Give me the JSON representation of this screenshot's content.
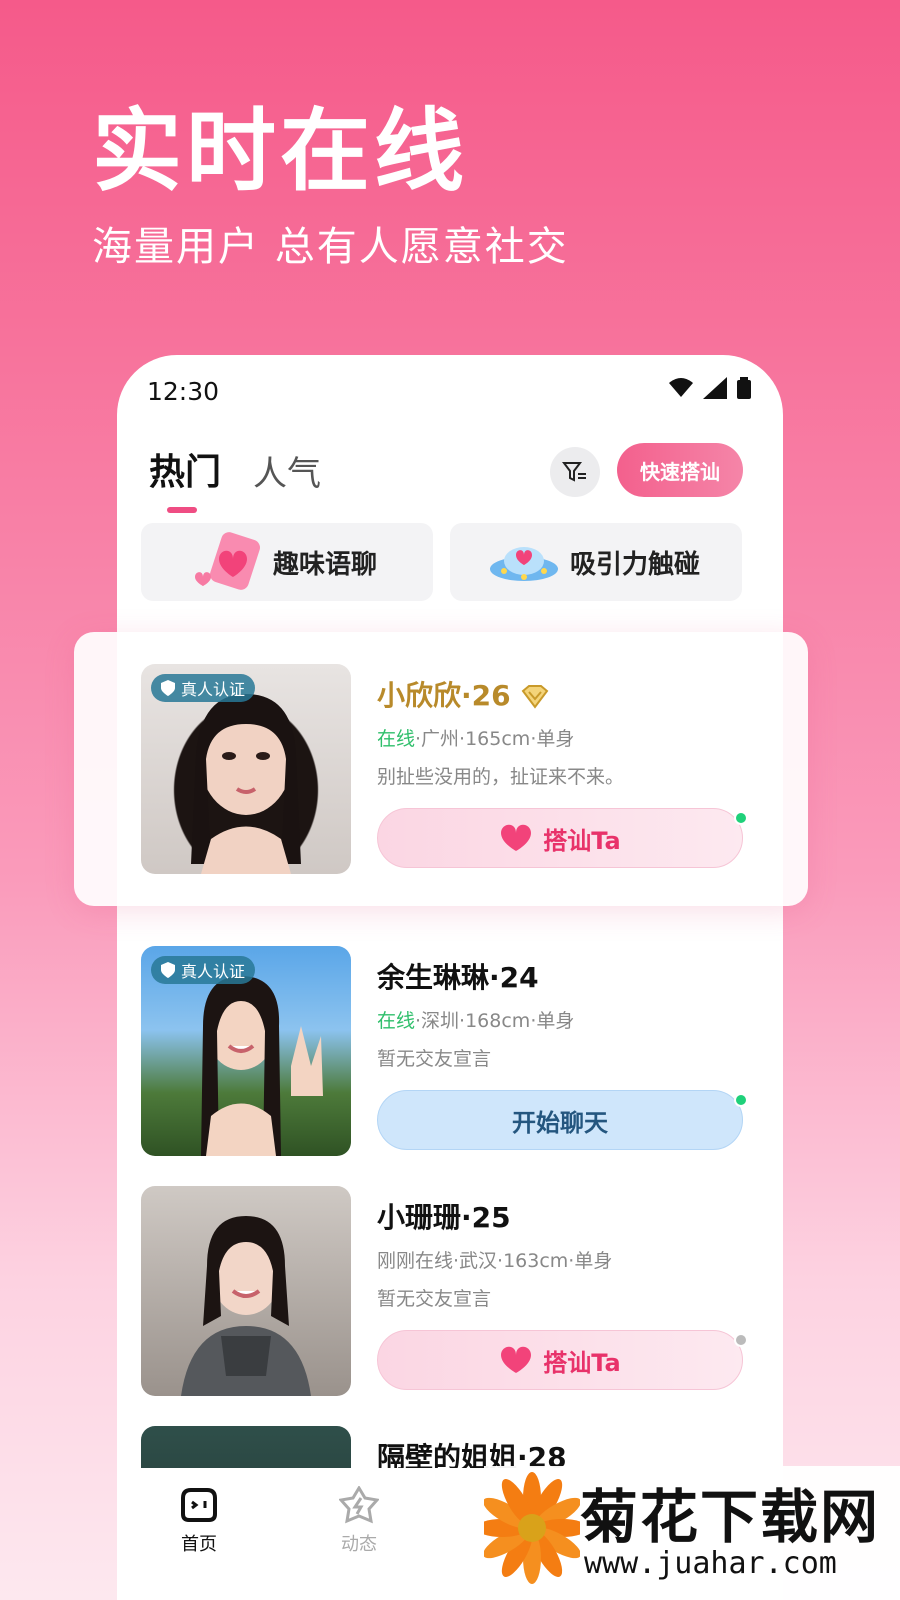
{
  "hero": {
    "title": "实时在线",
    "subtitle": "海量用户 总有人愿意社交"
  },
  "status_bar": {
    "time": "12:30"
  },
  "tabs": [
    {
      "label": "热门",
      "active": true
    },
    {
      "label": "人气",
      "active": false
    }
  ],
  "quick_button": "快速搭讪",
  "features": [
    {
      "label": "趣味语聊",
      "icon": "heart-phone-icon"
    },
    {
      "label": "吸引力触碰",
      "icon": "ufo-icon"
    }
  ],
  "users": [
    {
      "name": "小欣欣·26",
      "verified": "真人认证",
      "status": "在线",
      "info": "·广州·165cm·单身",
      "motto": "别扯些没用的，扯证来不来。",
      "action": "搭讪Ta",
      "action_style": "pink",
      "online_dot": "#1fd17a",
      "vip": true
    },
    {
      "name": "余生琳琳·24",
      "verified": "真人认证",
      "status": "在线",
      "info": "·深圳·168cm·单身",
      "motto": "暂无交友宣言",
      "action": "开始聊天",
      "action_style": "blue",
      "online_dot": "#1fd17a",
      "vip": false
    },
    {
      "name": "小珊珊·25",
      "verified": "",
      "status": "",
      "info": "刚刚在线·武汉·163cm·单身",
      "motto": "暂无交友宣言",
      "action": "搭讪Ta",
      "action_style": "pink",
      "online_dot": "#bbbbbb",
      "vip": false
    },
    {
      "name": "隔壁的姐姐·28",
      "verified": "",
      "status": "",
      "info": "",
      "motto": "",
      "action": "",
      "action_style": "",
      "online_dot": "",
      "vip": false
    }
  ],
  "bottom_nav": [
    {
      "label": "首页",
      "active": true
    },
    {
      "label": "动态",
      "active": false
    }
  ],
  "watermark": {
    "title": "菊花下载网",
    "url": "www.juahar.com"
  },
  "colors": {
    "accent": "#ef4d83",
    "online": "#2fbf6b"
  }
}
